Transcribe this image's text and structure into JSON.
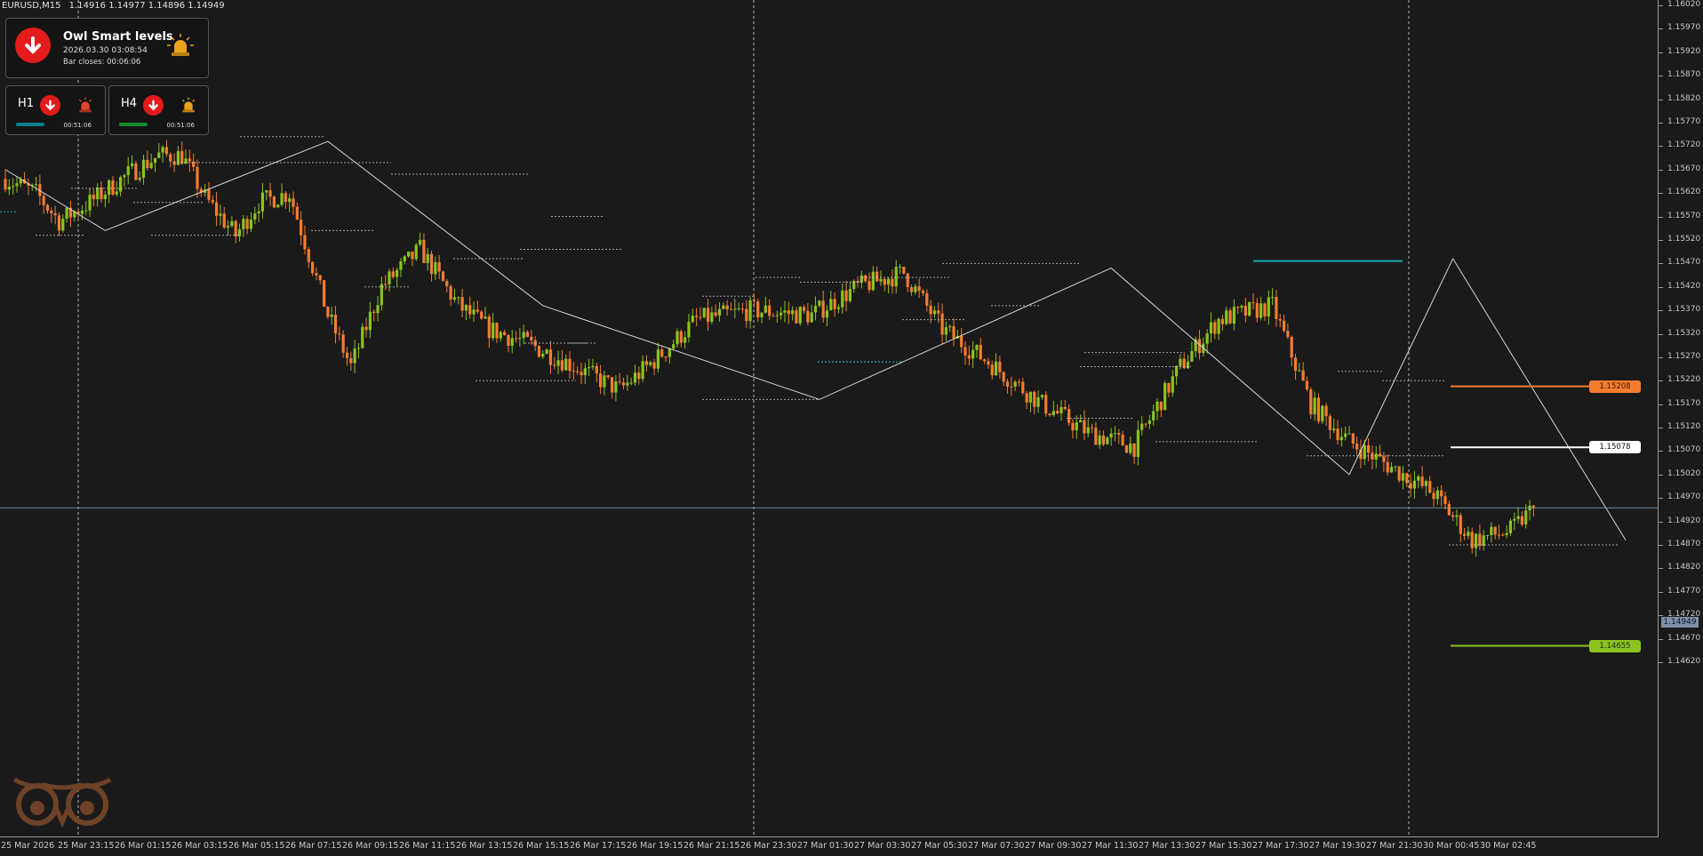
{
  "header": {
    "symbol": "EURUSD,M15",
    "ohlc": "1.14916 1.14977 1.14896 1.14949"
  },
  "indicator_panel": {
    "title": "Owl Smart levels",
    "datetime": "2026.03.30 03:08:54",
    "bar_closes": "Bar closes: 00:06:06",
    "direction": "down"
  },
  "timeframes": [
    {
      "label": "H1",
      "time": "00:51:06",
      "direction": "down",
      "progress_color": "#0a7e8c"
    },
    {
      "label": "H4",
      "time": "00:51:06",
      "direction": "down",
      "progress_color": "#158a2e"
    }
  ],
  "price_axis": {
    "labels": [
      "1.16020",
      "1.15970",
      "1.15920",
      "1.15870",
      "1.15820",
      "1.15770",
      "1.15720",
      "1.15670",
      "1.15620",
      "1.15570",
      "1.15520",
      "1.15470",
      "1.15420",
      "1.15370",
      "1.15320",
      "1.15270",
      "1.15220",
      "1.15170",
      "1.15120",
      "1.15070",
      "1.15020",
      "1.14970",
      "1.14920",
      "1.14870",
      "1.14820",
      "1.14770",
      "1.14720",
      "1.14670",
      "1.14620"
    ],
    "current": "1.14949"
  },
  "time_axis": {
    "labels": [
      "25 Mar 2026",
      "25 Mar 23:15",
      "26 Mar 01:15",
      "26 Mar 03:15",
      "26 Mar 05:15",
      "26 Mar 07:15",
      "26 Mar 09:15",
      "26 Mar 11:15",
      "26 Mar 13:15",
      "26 Mar 15:15",
      "26 Mar 17:15",
      "26 Mar 19:15",
      "26 Mar 21:15",
      "26 Mar 23:30",
      "27 Mar 01:30",
      "27 Mar 03:30",
      "27 Mar 05:30",
      "27 Mar 07:30",
      "27 Mar 09:30",
      "27 Mar 11:30",
      "27 Mar 13:30",
      "27 Mar 15:30",
      "27 Mar 17:30",
      "27 Mar 19:30",
      "27 Mar 21:30",
      "30 Mar 00:45",
      "30 Mar 02:45"
    ]
  },
  "levels": [
    {
      "label": "1.15208",
      "price": 1.15208,
      "color": "#f57c2f",
      "text_color": "#3a1600"
    },
    {
      "label": "1.15078",
      "price": 1.15078,
      "color": "#ffffff",
      "text_color": "#111111"
    },
    {
      "label": "1.14655",
      "price": 1.14655,
      "color": "#8bc320",
      "text_color": "#17290a"
    }
  ],
  "colors": {
    "bull": "#8bc320",
    "bear": "#f57c2f",
    "background": "#1a1a1a",
    "grid": "#cfcfcf",
    "zigzag": "#d8d8d8",
    "bid_line": "#7fa2b8"
  },
  "chart_data": {
    "type": "candlestick",
    "symbol": "EURUSD",
    "timeframe": "M15",
    "ylim": [
      1.14595,
      1.1603
    ],
    "close_path": [
      [
        0,
        1.1565
      ],
      [
        8,
        1.1562
      ],
      [
        14,
        1.1556
      ],
      [
        22,
        1.156
      ],
      [
        32,
        1.1566
      ],
      [
        40,
        1.157
      ],
      [
        46,
        1.157
      ],
      [
        52,
        1.1561
      ],
      [
        60,
        1.1553
      ],
      [
        66,
        1.156
      ],
      [
        74,
        1.1562
      ],
      [
        84,
        1.1536
      ],
      [
        90,
        1.1525
      ],
      [
        98,
        1.1542
      ],
      [
        108,
        1.155
      ],
      [
        118,
        1.1538
      ],
      [
        126,
        1.1533
      ],
      [
        136,
        1.153
      ],
      [
        146,
        1.1526
      ],
      [
        160,
        1.152
      ],
      [
        170,
        1.1527
      ],
      [
        180,
        1.1535
      ],
      [
        194,
        1.1537
      ],
      [
        210,
        1.1536
      ],
      [
        222,
        1.1542
      ],
      [
        234,
        1.1545
      ],
      [
        244,
        1.1533
      ],
      [
        256,
        1.1526
      ],
      [
        270,
        1.1517
      ],
      [
        282,
        1.1511
      ],
      [
        294,
        1.1508
      ],
      [
        306,
        1.1525
      ],
      [
        316,
        1.1535
      ],
      [
        330,
        1.1538
      ],
      [
        340,
        1.1517
      ],
      [
        350,
        1.1509
      ],
      [
        360,
        1.1504
      ],
      [
        372,
        1.1498
      ],
      [
        382,
        1.1488
      ],
      [
        392,
        1.149
      ],
      [
        398,
        1.14949
      ]
    ],
    "zigzag": [
      [
        0,
        1.1567
      ],
      [
        26,
        1.1554
      ],
      [
        84,
        1.1573
      ],
      [
        140,
        1.1538
      ],
      [
        212,
        1.1518
      ],
      [
        288,
        1.1546
      ],
      [
        350,
        1.1502
      ],
      [
        377,
        1.1548
      ],
      [
        422,
        1.1488
      ]
    ],
    "bid": 1.14949
  }
}
